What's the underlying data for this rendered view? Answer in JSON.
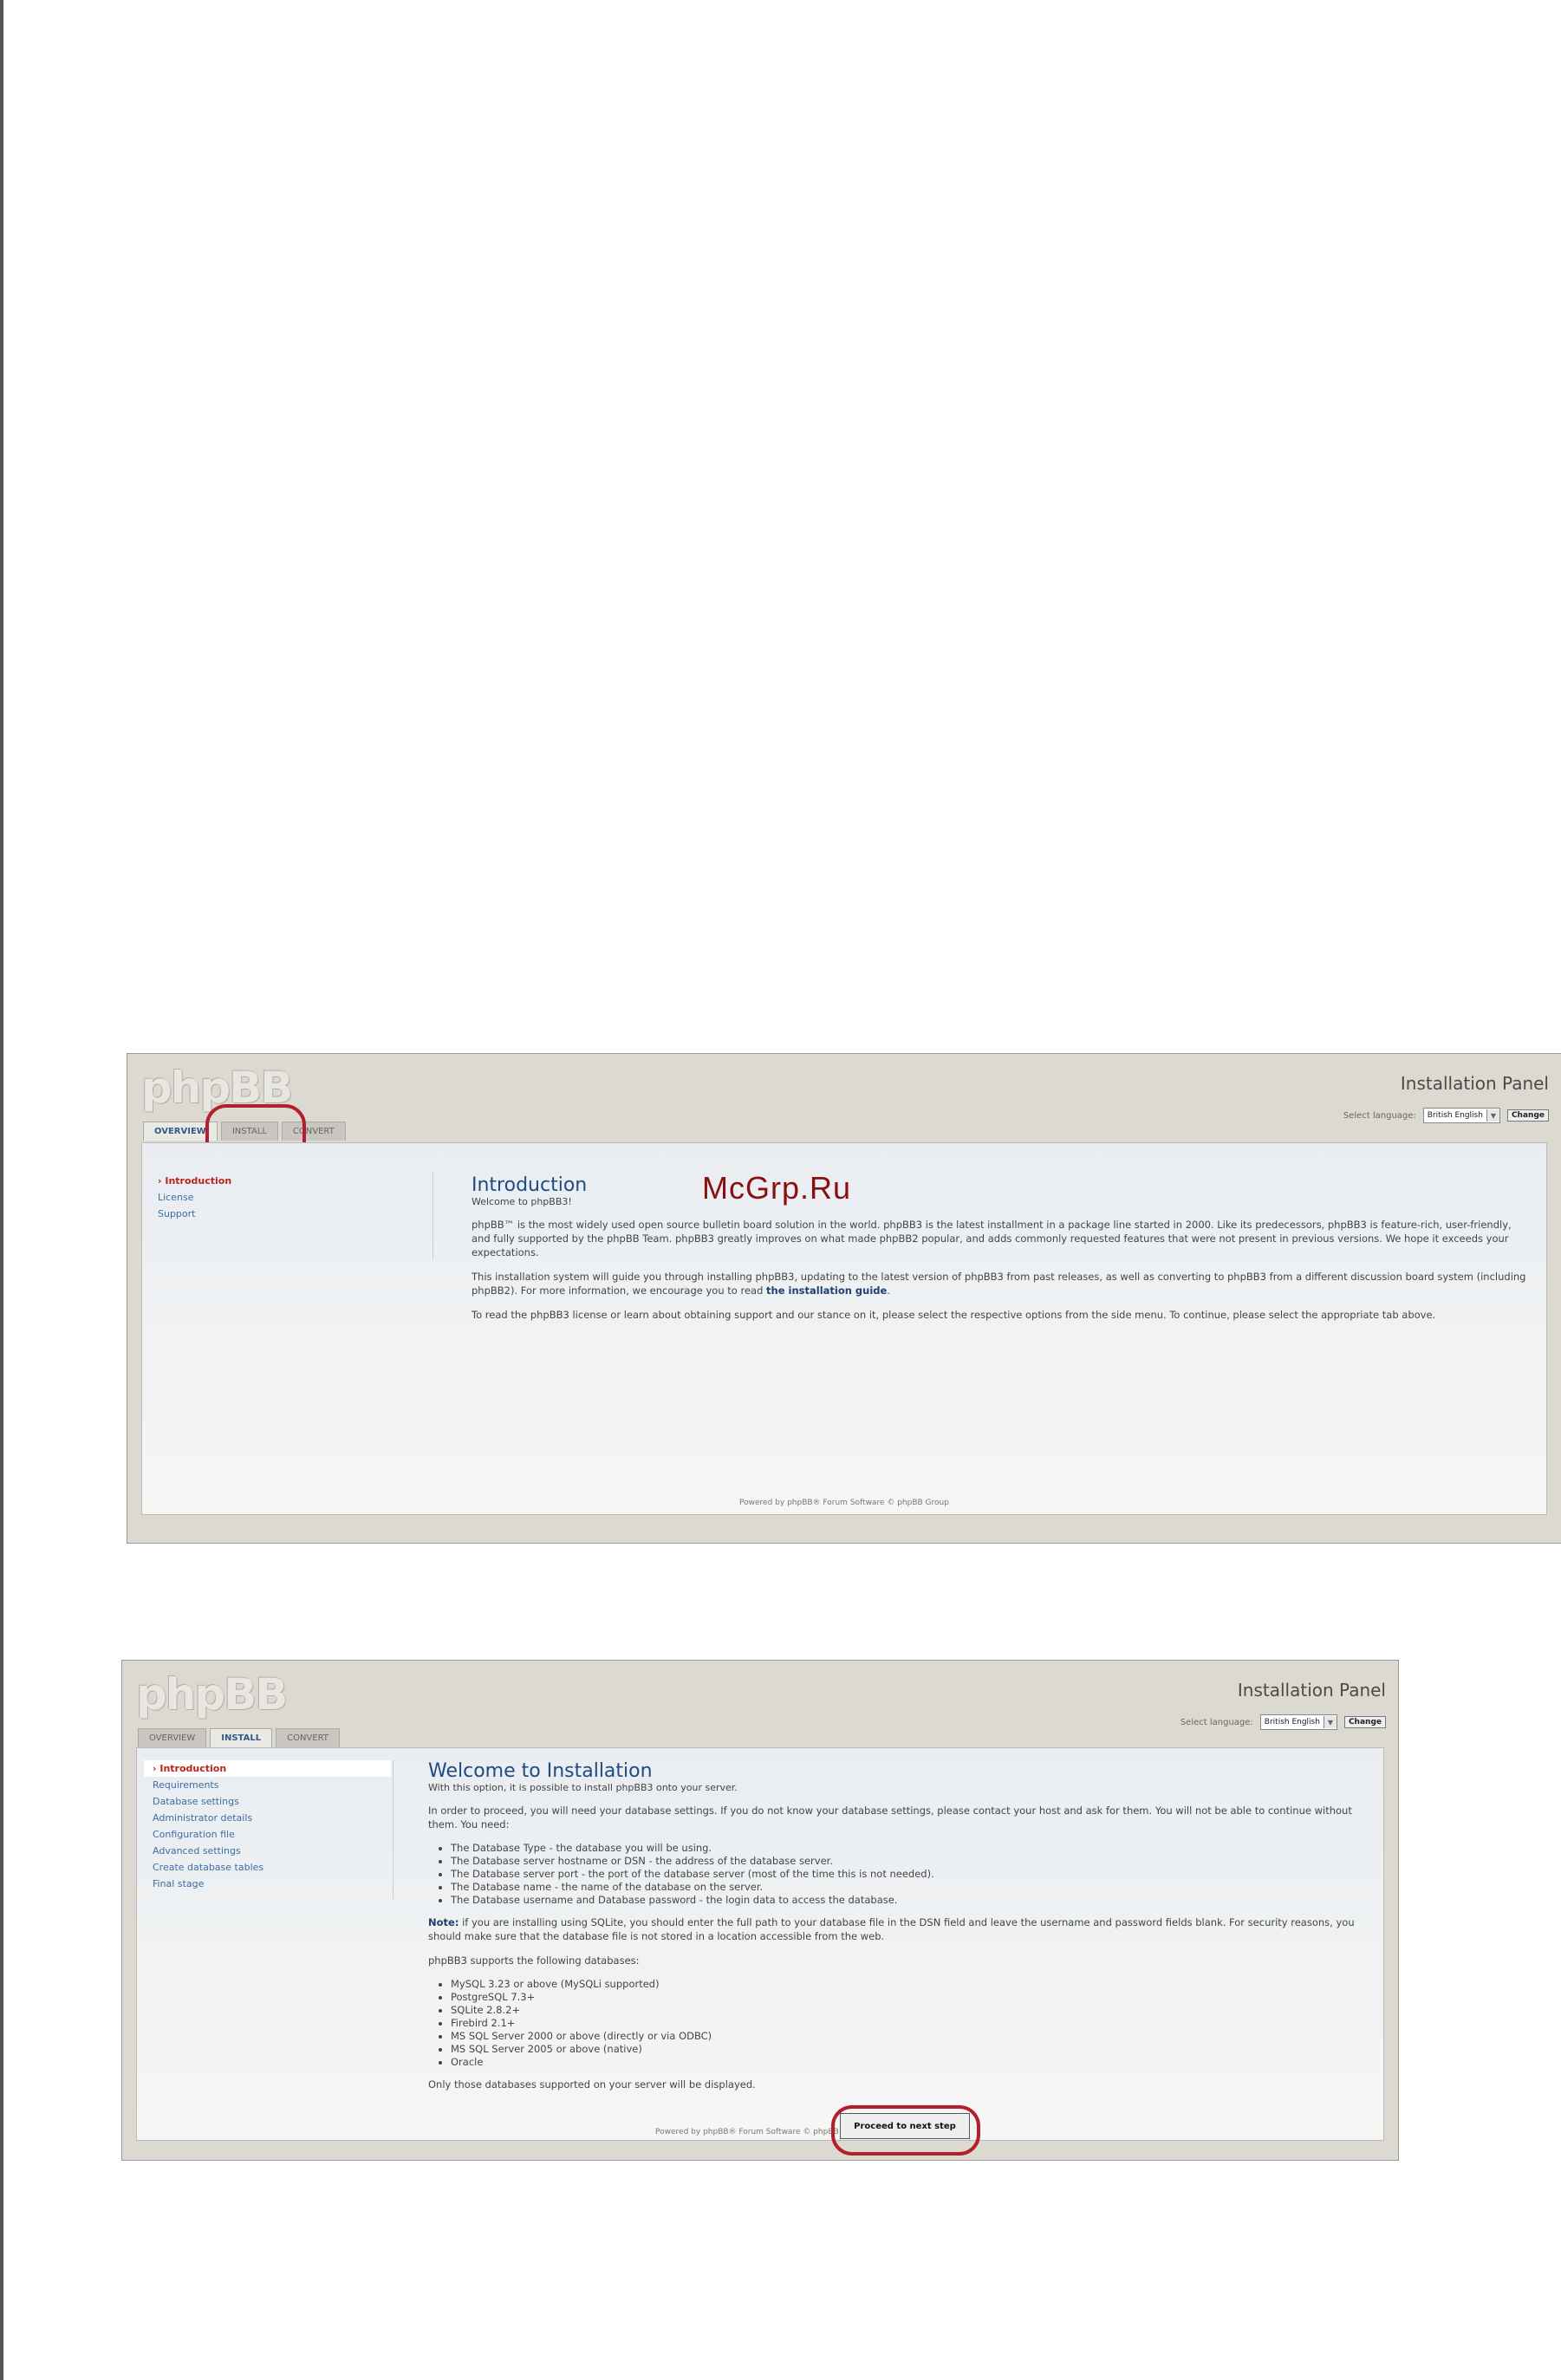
{
  "watermark": "McGrp.Ru",
  "screen1": {
    "logo": "phpBB",
    "panel_title": "Installation Panel",
    "lang_label": "Select language:",
    "lang_value": "British English",
    "change_label": "Change",
    "tabs": [
      "OVERVIEW",
      "INSTALL",
      "CONVERT"
    ],
    "menu": [
      "Introduction",
      "License",
      "Support"
    ],
    "title": "Introduction",
    "subtitle": "Welcome to phpBB3!",
    "p1": "phpBB™ is the most widely used open source bulletin board solution in the world. phpBB3 is the latest installment in a package line started in 2000. Like its predecessors, phpBB3 is feature-rich, user-friendly, and fully supported by the phpBB Team. phpBB3 greatly improves on what made phpBB2 popular, and adds commonly requested features that were not present in previous versions. We hope it exceeds your expectations.",
    "p2_a": "This installation system will guide you through installing phpBB3, updating to the latest version of phpBB3 from past releases, as well as converting to phpBB3 from a different discussion board system (including phpBB2). For more information, we encourage you to read ",
    "p2_link": "the installation guide",
    "p2_b": ".",
    "p3": "To read the phpBB3 license or learn about obtaining support and our stance on it, please select the respective options from the side menu. To continue, please select the appropriate tab above.",
    "footer": "Powered by phpBB® Forum Software © phpBB Group"
  },
  "screen2": {
    "logo": "phpBB",
    "panel_title": "Installation Panel",
    "lang_label": "Select language:",
    "lang_value": "British English",
    "change_label": "Change",
    "tabs": [
      "OVERVIEW",
      "INSTALL",
      "CONVERT"
    ],
    "menu": [
      "Introduction",
      "Requirements",
      "Database settings",
      "Administrator details",
      "Configuration file",
      "Advanced settings",
      "Create database tables",
      "Final stage"
    ],
    "title": "Welcome to Installation",
    "subtitle": "With this option, it is possible to install phpBB3 onto your server.",
    "p1": "In order to proceed, you will need your database settings. If you do not know your database settings, please contact your host and ask for them. You will not be able to continue without them. You need:",
    "needs": [
      "The Database Type - the database you will be using.",
      "The Database server hostname or DSN - the address of the database server.",
      "The Database server port - the port of the database server (most of the time this is not needed).",
      "The Database name - the name of the database on the server.",
      "The Database username and Database password - the login data to access the database."
    ],
    "note_label": "Note:",
    "note": " if you are installing using SQLite, you should enter the full path to your database file in the DSN field and leave the username and password fields blank. For security reasons, you should make sure that the database file is not stored in a location accessible from the web.",
    "supports": "phpBB3 supports the following databases:",
    "databases": [
      "MySQL 3.23 or above (MySQLi supported)",
      "PostgreSQL 7.3+",
      "SQLite 2.8.2+",
      "Firebird 2.1+",
      "MS SQL Server 2000 or above (directly or via ODBC)",
      "MS SQL Server 2005 or above (native)",
      "Oracle"
    ],
    "only": "Only those databases supported on your server will be displayed.",
    "proceed": "Proceed to next step",
    "footer": "Powered by phpBB® Forum Software © phpBB Group"
  }
}
